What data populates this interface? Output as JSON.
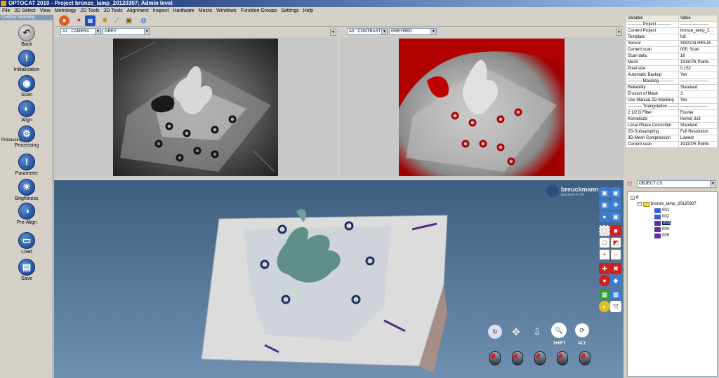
{
  "window": {
    "title": "OPTOCAT 2010 - Project bronze_lamp_20120307; Admin level"
  },
  "menu": [
    "File",
    "3D Select",
    "View",
    "Metrology",
    "2D Tools",
    "3D Tools",
    "Alignment",
    "Inspect",
    "Hardware",
    "Macro",
    "Windows",
    "Function Groups",
    "Settings",
    "Help"
  ],
  "sidebar": {
    "header": "Contour Matching",
    "processing_label": "Processing",
    "buttons": [
      {
        "label": "Back",
        "icon": "back-icon"
      },
      {
        "label": "Initialisation",
        "icon": "exclamation-icon"
      },
      {
        "label": "Scan",
        "icon": "scan-icon"
      },
      {
        "label": "Align",
        "icon": "align-icon"
      },
      {
        "label": "Processing",
        "icon": "processing-icon"
      },
      {
        "label": "Parameter",
        "icon": "exclamation-icon"
      },
      {
        "label": "Brightness",
        "icon": "brightness-icon"
      },
      {
        "label": "Pre-Align",
        "icon": "pre-align-icon"
      },
      {
        "label": "Load",
        "icon": "folder-icon"
      },
      {
        "label": "Save",
        "icon": "floppy-icon"
      }
    ]
  },
  "viewports": {
    "left": {
      "channel": "A1 : CAMERA",
      "mode": "GREY"
    },
    "right": {
      "channel": "A3 : CONTRAST",
      "mode": "GREYRED"
    }
  },
  "variables": {
    "headers": [
      "Variable",
      "Value"
    ],
    "rows": [
      [
        "---------- Project ----------",
        "--------------------"
      ],
      [
        "Current Project",
        "bronze_lamp_2..."
      ],
      [
        "Template",
        "full"
      ],
      [
        "Sensor",
        "SM2104-HE5-M..."
      ],
      [
        "Current scan",
        "005. Scan"
      ],
      [
        "Scan data",
        "16"
      ],
      [
        "Mesh",
        "1911076 Points"
      ],
      [
        "Pixel size",
        "0.152"
      ],
      [
        "Automatic Backup",
        "Yes"
      ],
      [
        "---------- Masking ----------",
        "--------------------"
      ],
      [
        "Reliability",
        "Standard"
      ],
      [
        "Erosion of Mask",
        "3"
      ],
      [
        "Use Manual 2D-Masking",
        "Yes"
      ],
      [
        "---------- Triangulation ----------",
        "--------------------"
      ],
      [
        "2 1/2 D Filter",
        "Fourier"
      ],
      [
        "Kernelsize",
        "Kernel 3x3"
      ],
      [
        "Local Phase Correction",
        "Standard"
      ],
      [
        "2D-Subsampling",
        "Full Resolution"
      ],
      [
        "3D-Mesh Compression",
        "Lowest"
      ],
      [
        "Current scan",
        "1911076 Points"
      ]
    ]
  },
  "tree": {
    "cs": "OBJECT CS",
    "root": "//",
    "project": "bronze_lamp_20120307",
    "items": [
      "001",
      "002",
      "003",
      "004",
      "005"
    ],
    "selected": "003"
  },
  "view3d": {
    "brand": "breuckmann",
    "tagline": "precision in 3D",
    "shift_label": "SHIFT",
    "alt_label": "ALT"
  }
}
